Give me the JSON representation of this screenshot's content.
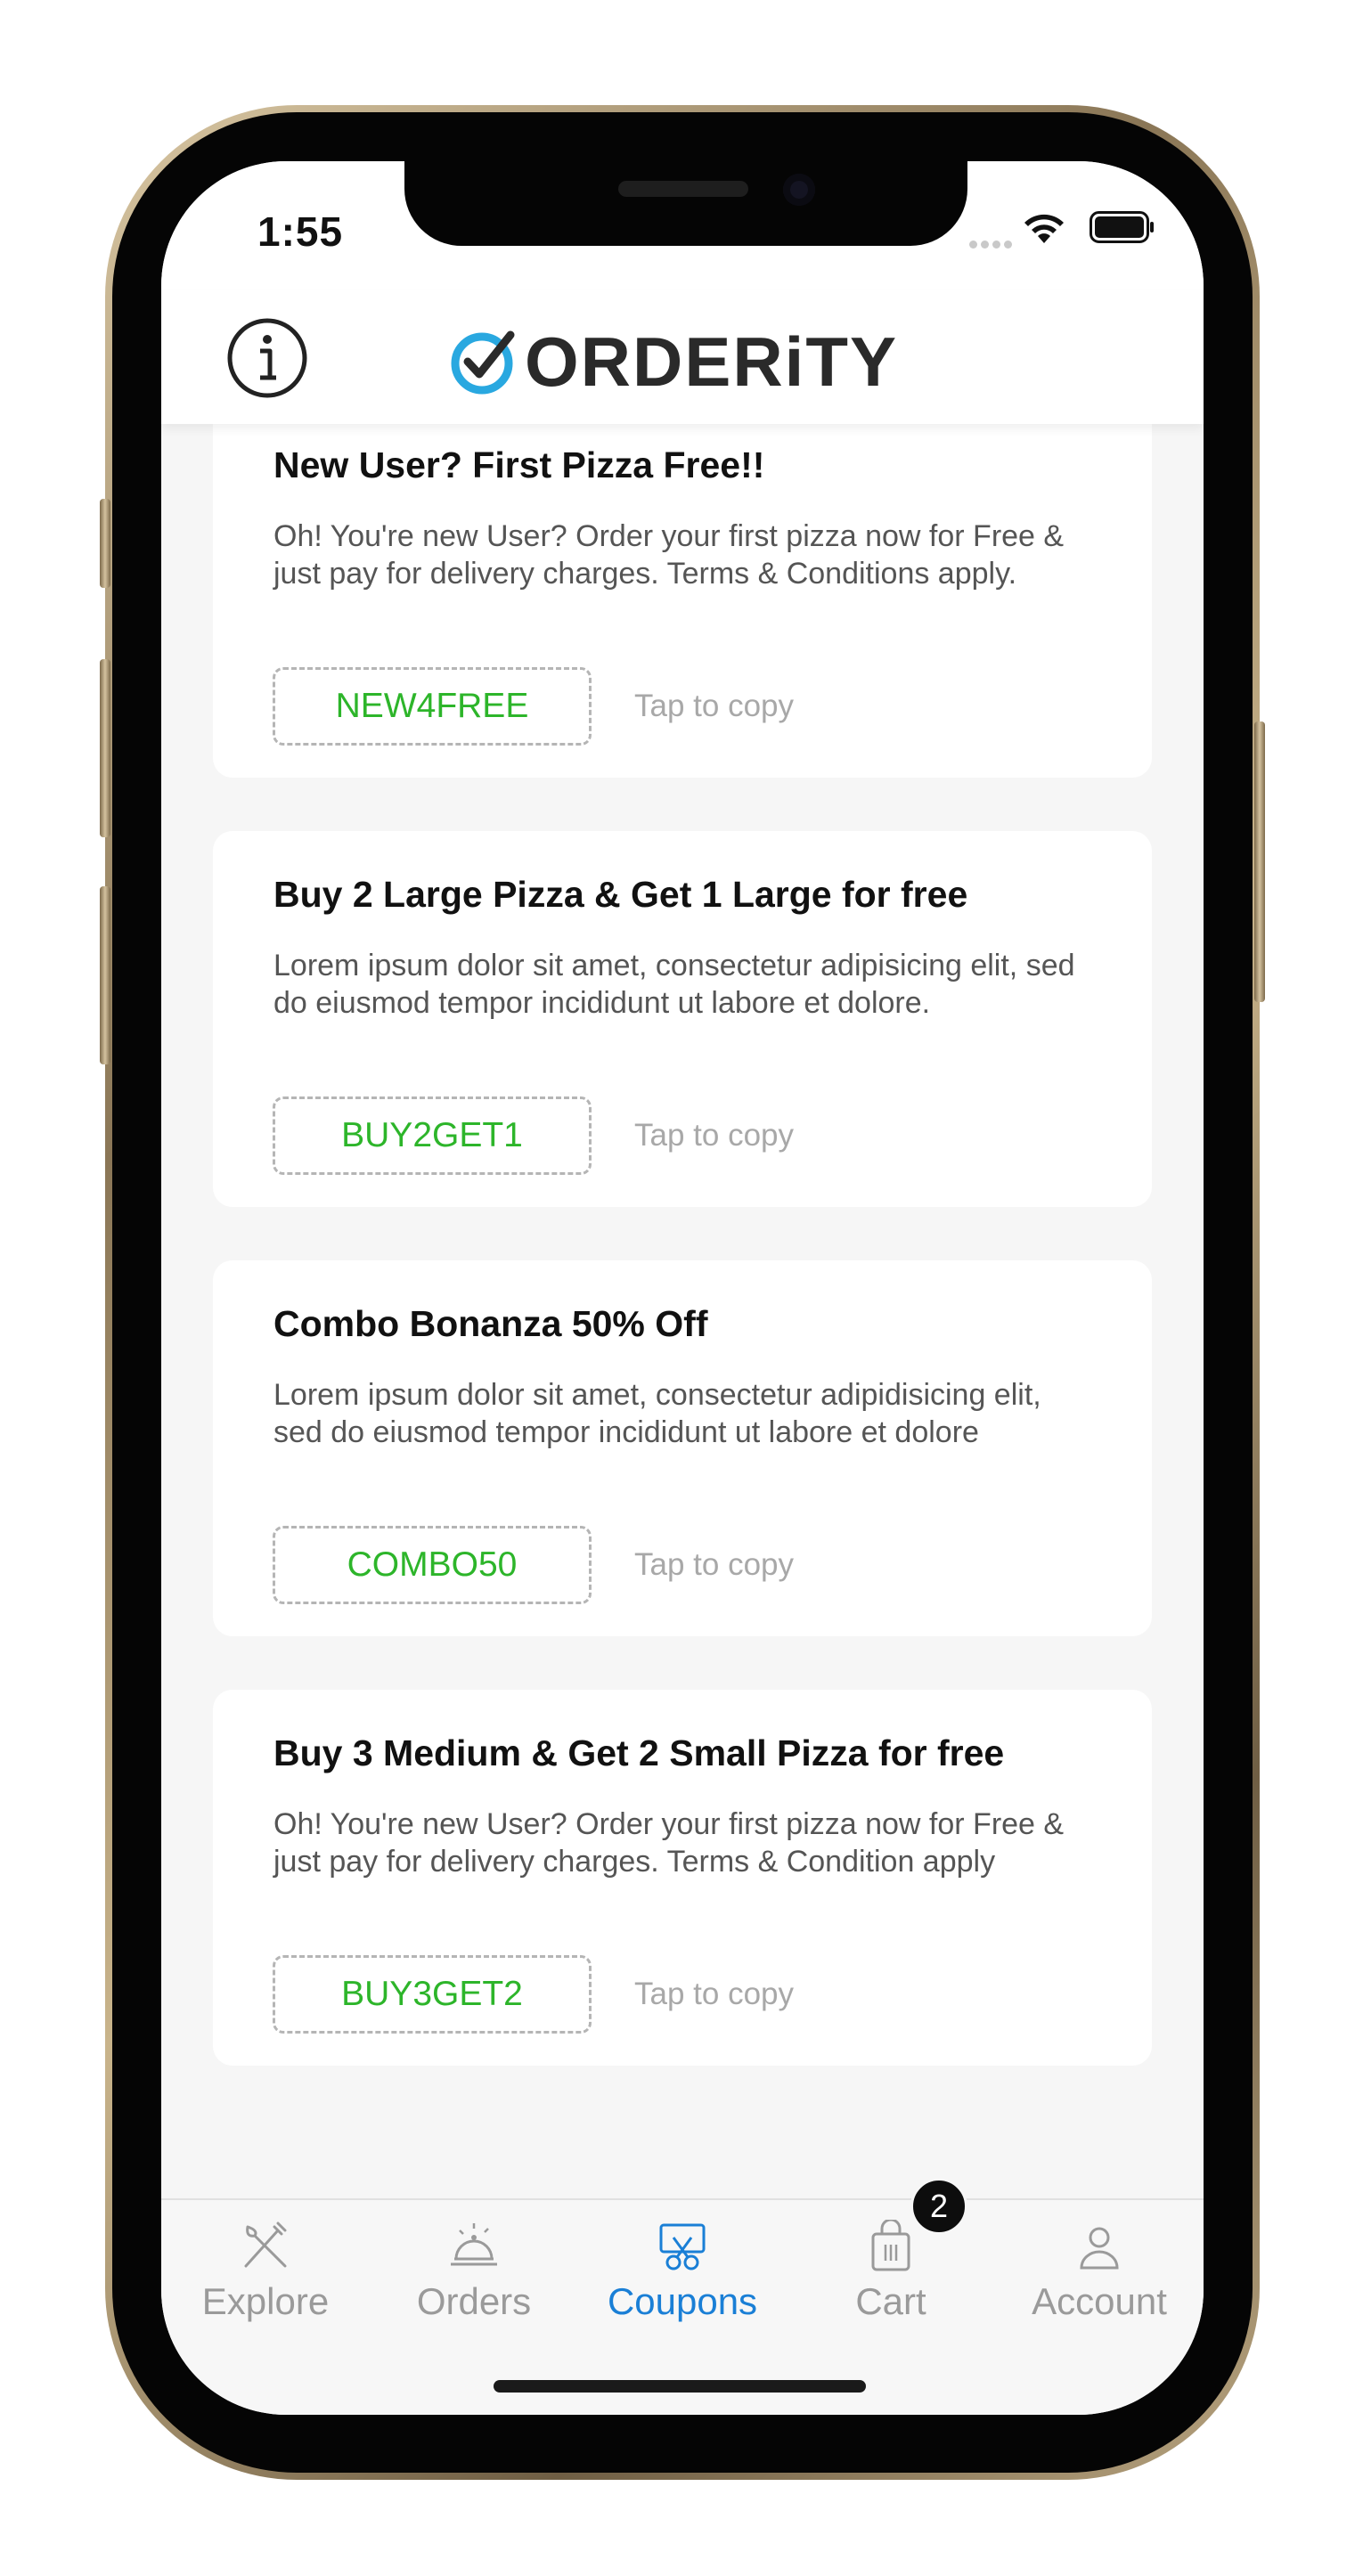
{
  "status_bar": {
    "time": "1:55"
  },
  "header": {
    "logo_text": "ORDERiTY",
    "brand_color": "#29a8e0"
  },
  "coupons": [
    {
      "title": "New User? First Pizza Free!!",
      "description": "Oh! You're new User? Order your first pizza now for Free & just pay for delivery charges. Terms & Conditions apply.",
      "code": "NEW4FREE",
      "copy_hint": "Tap to copy"
    },
    {
      "title": "Buy 2 Large Pizza & Get 1 Large for free",
      "description": "Lorem ipsum dolor sit amet, consectetur adipisicing elit, sed do eiusmod tempor incididunt ut labore et dolore.",
      "code": "BUY2GET1",
      "copy_hint": "Tap to copy"
    },
    {
      "title": "Combo Bonanza 50% Off",
      "description": "Lorem ipsum dolor sit amet, consectetur adipidisicing elit, sed do eiusmod tempor incididunt ut labore et dolore",
      "code": "COMBO50",
      "copy_hint": "Tap to copy"
    },
    {
      "title": "Buy 3 Medium & Get 2 Small Pizza for free",
      "description": "Oh! You're new User? Order your first pizza now for Free & just pay for delivery charges. Terms & Condition apply",
      "code": "BUY3GET2",
      "copy_hint": "Tap to copy"
    }
  ],
  "tabbar": {
    "tabs": [
      {
        "label": "Explore",
        "icon": "fork-knife-icon"
      },
      {
        "label": "Orders",
        "icon": "cloche-icon"
      },
      {
        "label": "Coupons",
        "icon": "coupon-scissors-icon",
        "active": true
      },
      {
        "label": "Cart",
        "icon": "shopping-bag-icon"
      },
      {
        "label": "Account",
        "icon": "user-icon"
      }
    ],
    "cart_badge": "2",
    "active_color": "#1a7fd6",
    "inactive_color": "#9a9a9a"
  },
  "code_color": "#2db52a"
}
